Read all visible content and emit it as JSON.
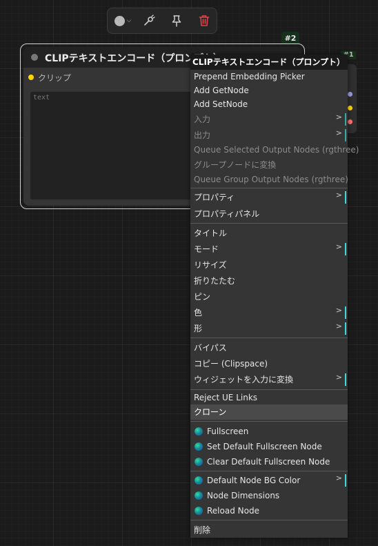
{
  "toolbar": {
    "color_icon": "color-circle-icon",
    "lasso_icon": "lasso-icon",
    "pin_icon": "pin-icon",
    "delete_icon": "trash-icon",
    "delete_color": "#e2434b"
  },
  "node": {
    "badge": "#2",
    "title": "CLIPテキストエンコード（プロンプト）",
    "input_label": "クリップ",
    "text_placeholder": "text"
  },
  "node_behind": {
    "badge": "#1"
  },
  "menu": {
    "title": "CLIPテキストエンコード（プロンプト）",
    "items": [
      {
        "label": "Prepend Embedding Picker"
      },
      {
        "label": "Add GetNode"
      },
      {
        "label": "Add SetNode"
      },
      {
        "label": "入力"
      },
      {
        "label": "出力"
      },
      {
        "label": "Queue Selected Output Nodes (rgthree)"
      },
      {
        "label": "グループノードに変換"
      },
      {
        "label": "Queue Group Output Nodes (rgthree)"
      },
      {
        "label": "プロパティ"
      },
      {
        "label": "プロパティパネル"
      },
      {
        "label": "タイトル"
      },
      {
        "label": "モード"
      },
      {
        "label": "リサイズ"
      },
      {
        "label": "折りたたむ"
      },
      {
        "label": "ピン"
      },
      {
        "label": "色"
      },
      {
        "label": "形"
      },
      {
        "label": "バイパス"
      },
      {
        "label": "コピー (Clipspace)"
      },
      {
        "label": "ウィジェットを入力に変換"
      },
      {
        "label": "Reject UE Links"
      },
      {
        "label": "クローン"
      },
      {
        "label": "Fullscreen"
      },
      {
        "label": "Set Default Fullscreen Node"
      },
      {
        "label": "Clear Default Fullscreen Node"
      },
      {
        "label": "Default Node BG Color"
      },
      {
        "label": "Node Dimensions"
      },
      {
        "label": "Reload Node"
      },
      {
        "label": "削除"
      }
    ],
    "submenu_arrow": ">"
  }
}
